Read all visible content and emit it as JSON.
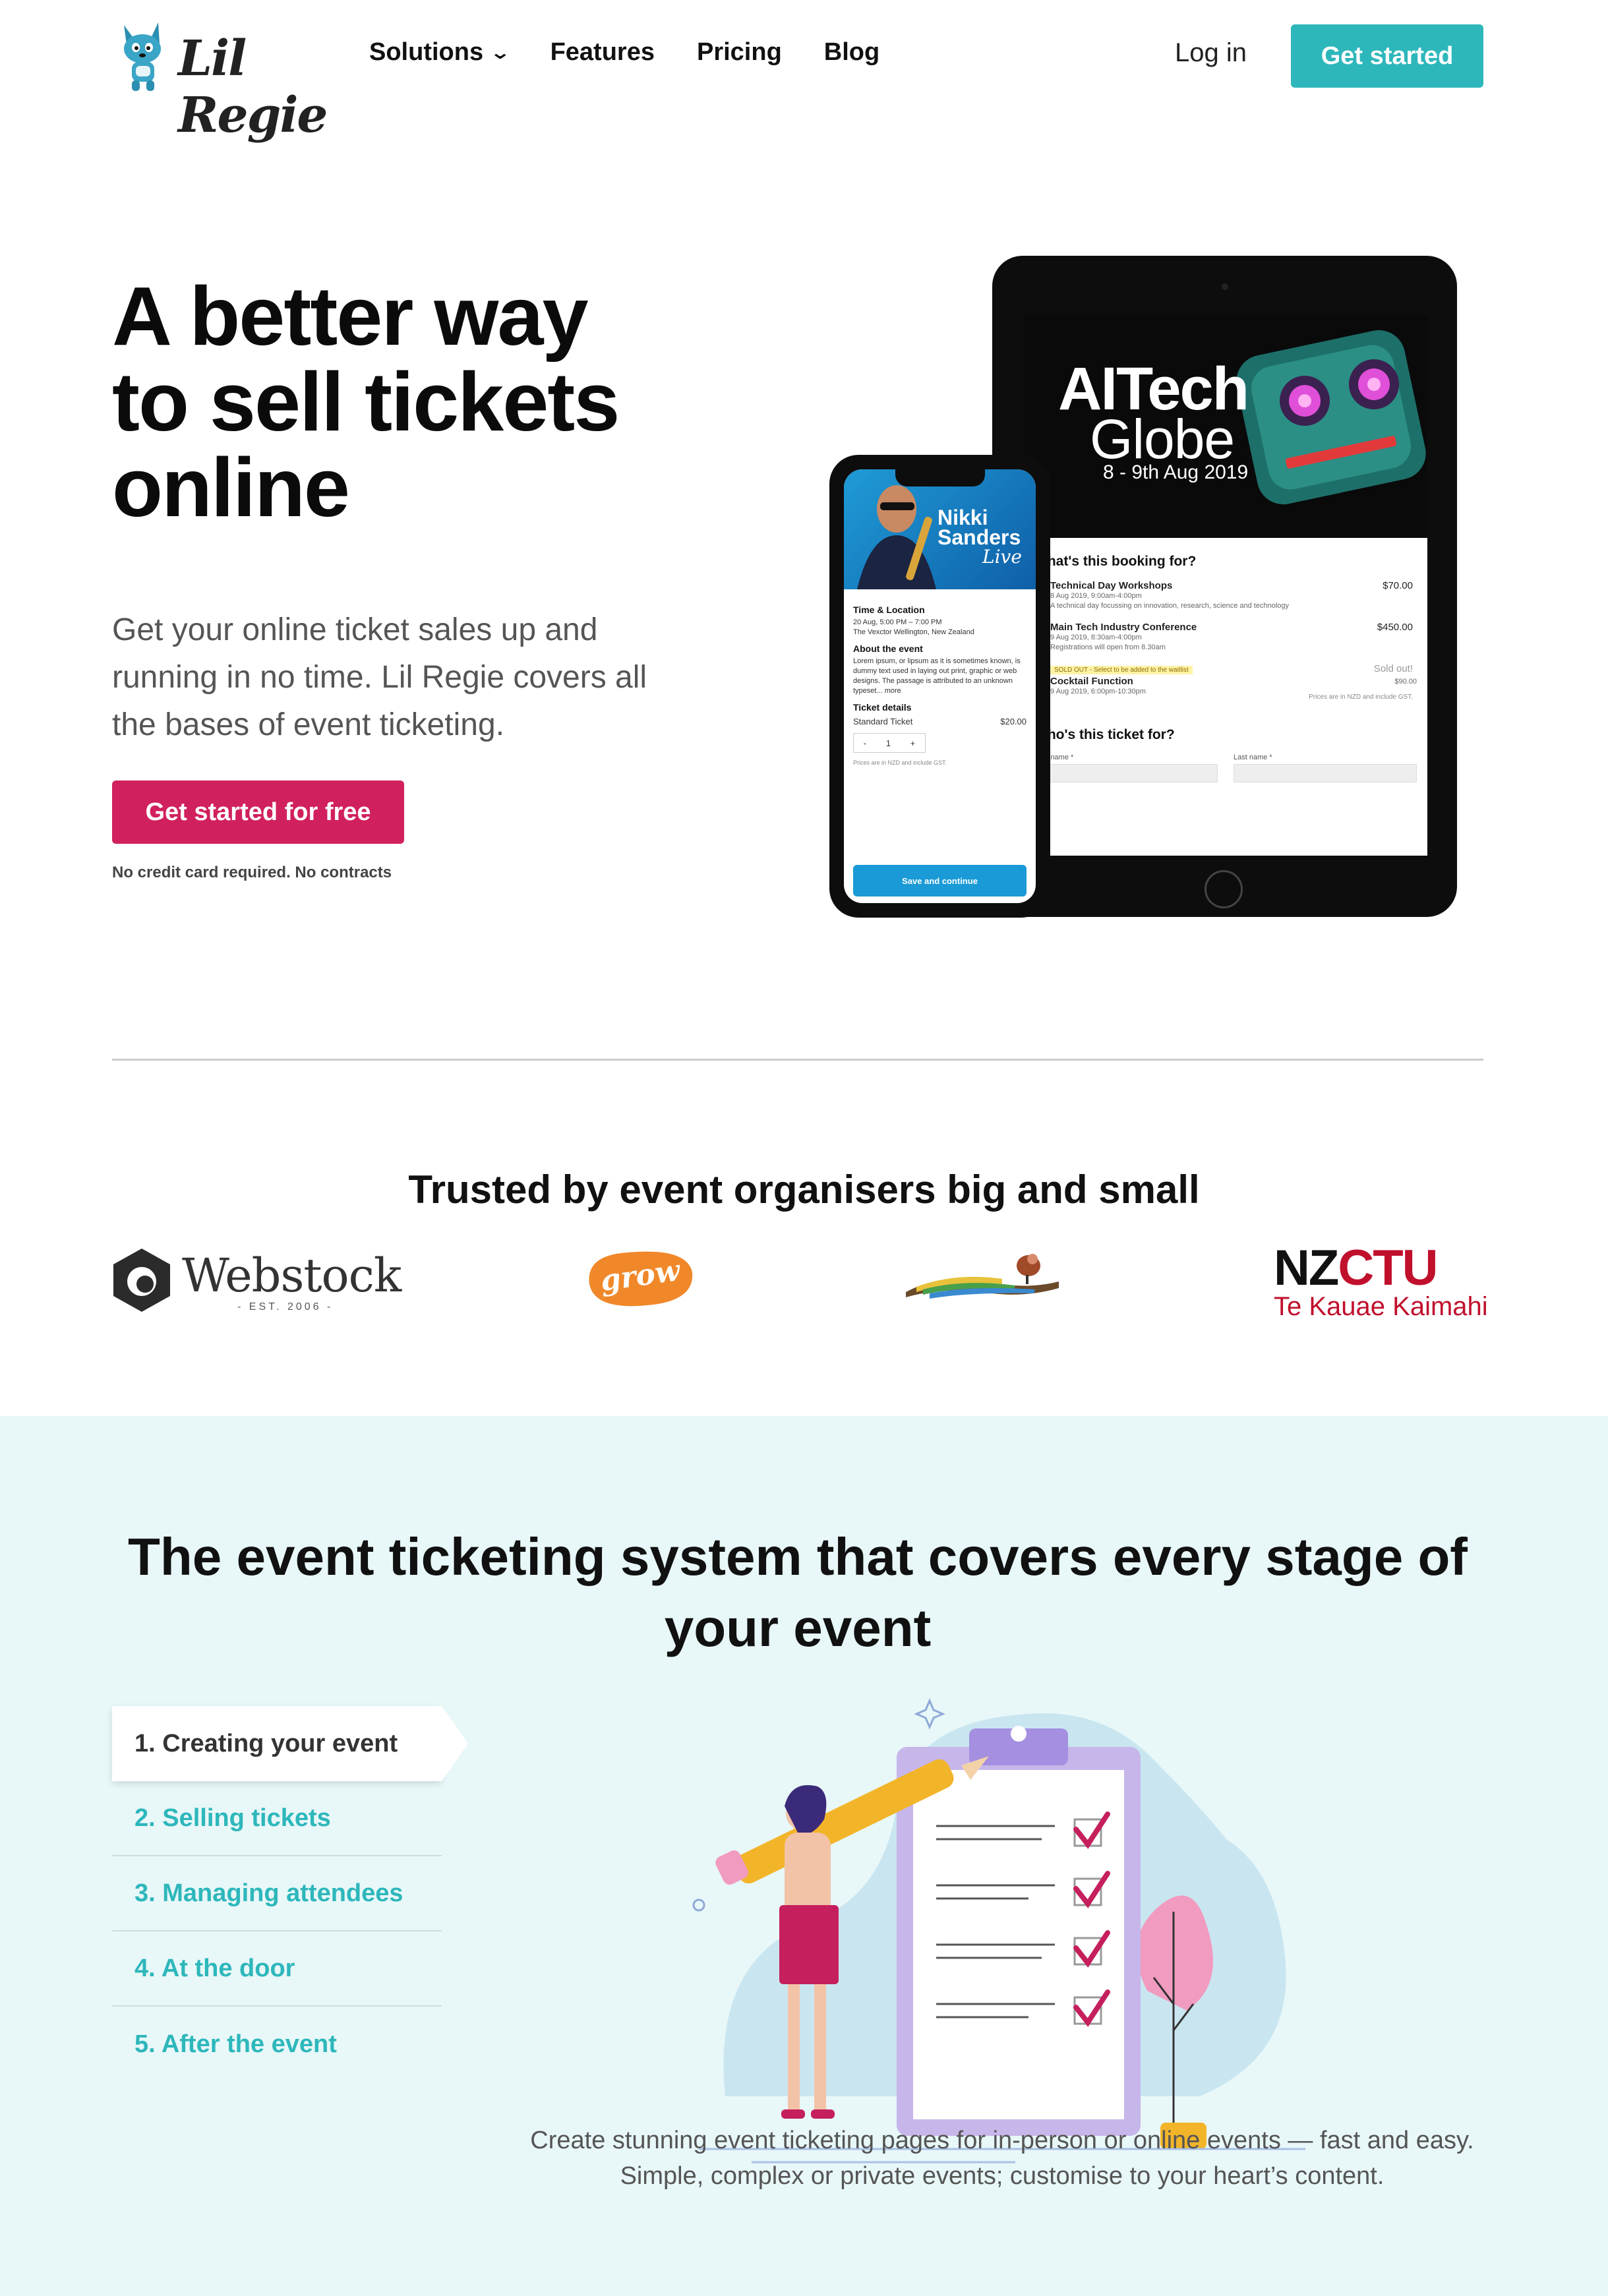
{
  "nav": {
    "logo_text": "Lil Regie",
    "links": [
      {
        "label": "Solutions",
        "has_dropdown": true
      },
      {
        "label": "Features"
      },
      {
        "label": "Pricing"
      },
      {
        "label": "Blog"
      }
    ],
    "login": "Log in",
    "cta": "Get started"
  },
  "hero": {
    "title_lines": [
      "A better way",
      "to sell tickets",
      "online"
    ],
    "subtitle": "Get your online ticket sales up and running in no time. Lil Regie covers all the bases of event ticketing.",
    "cta": "Get started for free",
    "note": "No credit card required. No contracts"
  },
  "tablet": {
    "event_title_1": "AITech",
    "event_title_2": "Globe",
    "event_dates": "8 - 9th Aug 2019",
    "booking_heading": "What's this booking for?",
    "items": [
      {
        "name": "Technical Day Workshops",
        "price": "$70.00",
        "time": "8 Aug 2019, 9:00am-4:00pm",
        "desc": "A technical day focussing on innovation, research, science and technology"
      },
      {
        "name": "Main Tech Industry Conference",
        "price": "$450.00",
        "time": "9 Aug 2019, 8:30am-4:00pm",
        "desc": "Registrations will open from 8.30am"
      },
      {
        "name": "Cocktail Function",
        "price": "Sold out!",
        "price_sub": "$90.00",
        "time": "9 Aug 2019, 6:00pm-10:30pm",
        "sold_badge": "SOLD OUT - Select to be added to the waitlist"
      }
    ],
    "gst_note": "Prices are in NZD and include GST.",
    "ticket_heading": "Who's this ticket for?",
    "first_name_label": "First name *",
    "last_name_label": "Last name *"
  },
  "phone": {
    "event_title_1": "Nikki",
    "event_title_2": "Sanders",
    "event_title_3": "Live",
    "time_heading": "Time & Location",
    "time_line": "20 Aug, 5:00 PM – 7:00 PM",
    "venue_line": "The Vexctor Wellington, New Zealand",
    "about_heading": "About the event",
    "about_text": "Lorem ipsum, or lipsum as it is sometimes known, is dummy text used in laying out print, graphic or web designs. The passage is attributed to an unknown typeset... more",
    "ticket_heading": "Ticket details",
    "ticket_name": "Standard Ticket",
    "ticket_price": "$20.00",
    "qty_minus": "-",
    "qty_value": "1",
    "qty_plus": "+",
    "gst_note": "Prices are in NZD and include GST.",
    "button": "Save and continue"
  },
  "trusted": {
    "title": "Trusted by event organisers big and small",
    "logos": {
      "webstock": "Webstock",
      "webstock_sub": "- EST. 2006 -",
      "grow": "grow",
      "nzctu_a": "NZ",
      "nzctu_b": "CTU",
      "nzctu_sub": "Te Kauae Kaimahi"
    }
  },
  "stages": {
    "title": "The event ticketing system that covers every stage of your event",
    "tabs": [
      {
        "label": "1. Creating your event",
        "active": true
      },
      {
        "label": "2. Selling tickets"
      },
      {
        "label": "3. Managing attendees"
      },
      {
        "label": "4. At the door"
      },
      {
        "label": "5. After the event"
      }
    ],
    "description": "Create stunning event ticketing pages for in-person or online events — fast and easy. Simple, complex or private events; customise to your heart’s content."
  },
  "colors": {
    "teal": "#2db7bb",
    "pink": "#d1205e",
    "stage_bg": "#e8f7f8",
    "nzctu_red": "#c0102c"
  }
}
